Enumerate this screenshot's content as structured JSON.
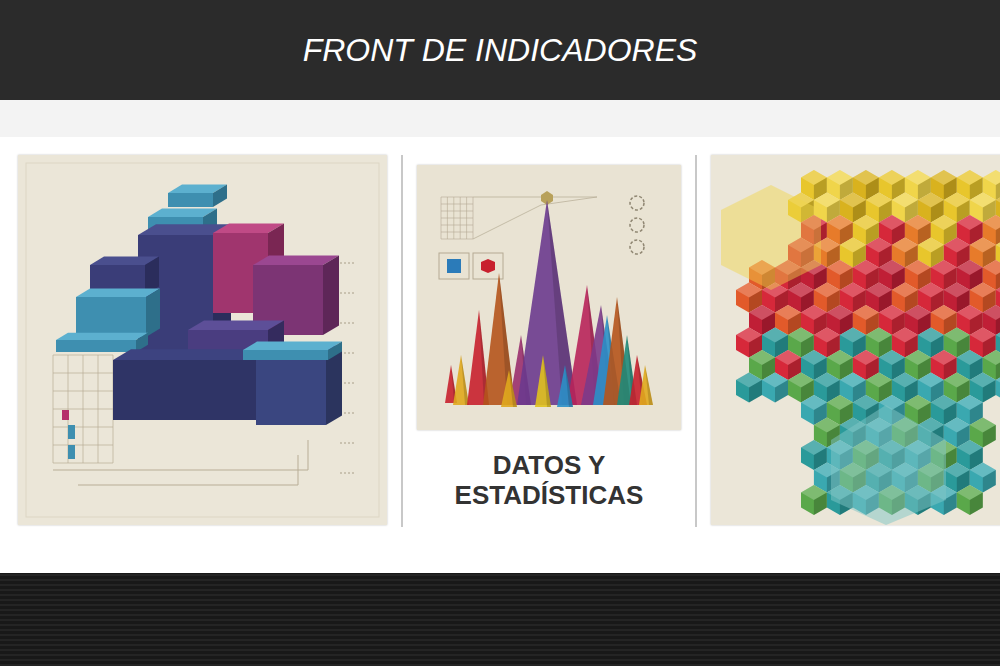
{
  "header": {
    "title": "FRONT DE INDICADORES"
  },
  "cards": [
    {
      "kind": "image"
    },
    {
      "kind": "captioned",
      "label": "DATOS Y ESTADÍSTICAS"
    },
    {
      "kind": "image"
    }
  ]
}
